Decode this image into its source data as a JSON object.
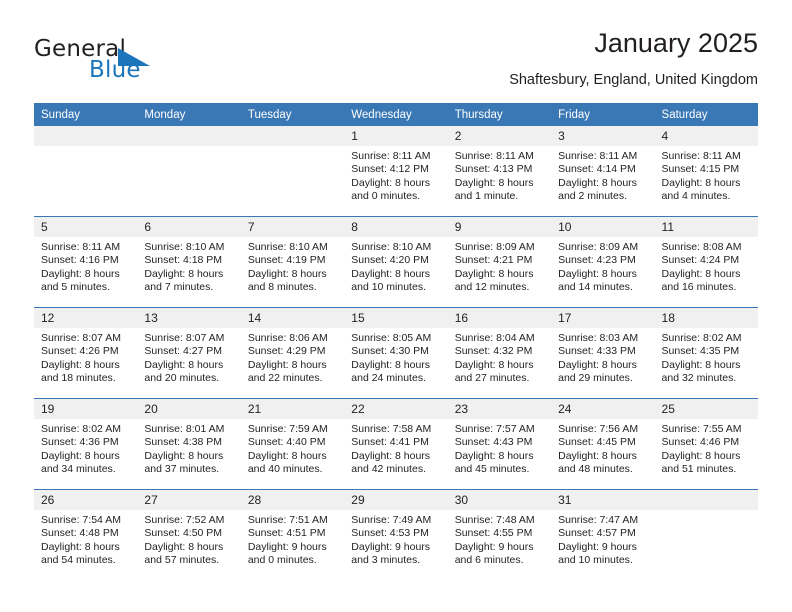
{
  "brand": {
    "word_one": "General",
    "word_two": "Blue",
    "triangle_icon": "triangle-icon",
    "colors": {
      "general": "#231f20",
      "blue": "#1b75bb"
    }
  },
  "header": {
    "title": "January 2025",
    "subtitle": "Shaftesbury, England, United Kingdom"
  },
  "theme": {
    "header_blue": "#3a78b5",
    "daynum_gray": "#f0f0f0",
    "text": "#231f20"
  },
  "calendar": {
    "weekday_headers": [
      "Sunday",
      "Monday",
      "Tuesday",
      "Wednesday",
      "Thursday",
      "Friday",
      "Saturday"
    ],
    "leading_blanks": 3,
    "weeks": [
      [
        {
          "blank": true
        },
        {
          "blank": true
        },
        {
          "blank": true
        },
        {
          "day": "1",
          "sunrise": "Sunrise: 8:11 AM",
          "sunset": "Sunset: 4:12 PM",
          "daylight_1": "Daylight: 8 hours",
          "daylight_2": "and 0 minutes."
        },
        {
          "day": "2",
          "sunrise": "Sunrise: 8:11 AM",
          "sunset": "Sunset: 4:13 PM",
          "daylight_1": "Daylight: 8 hours",
          "daylight_2": "and 1 minute."
        },
        {
          "day": "3",
          "sunrise": "Sunrise: 8:11 AM",
          "sunset": "Sunset: 4:14 PM",
          "daylight_1": "Daylight: 8 hours",
          "daylight_2": "and 2 minutes."
        },
        {
          "day": "4",
          "sunrise": "Sunrise: 8:11 AM",
          "sunset": "Sunset: 4:15 PM",
          "daylight_1": "Daylight: 8 hours",
          "daylight_2": "and 4 minutes."
        }
      ],
      [
        {
          "day": "5",
          "sunrise": "Sunrise: 8:11 AM",
          "sunset": "Sunset: 4:16 PM",
          "daylight_1": "Daylight: 8 hours",
          "daylight_2": "and 5 minutes."
        },
        {
          "day": "6",
          "sunrise": "Sunrise: 8:10 AM",
          "sunset": "Sunset: 4:18 PM",
          "daylight_1": "Daylight: 8 hours",
          "daylight_2": "and 7 minutes."
        },
        {
          "day": "7",
          "sunrise": "Sunrise: 8:10 AM",
          "sunset": "Sunset: 4:19 PM",
          "daylight_1": "Daylight: 8 hours",
          "daylight_2": "and 8 minutes."
        },
        {
          "day": "8",
          "sunrise": "Sunrise: 8:10 AM",
          "sunset": "Sunset: 4:20 PM",
          "daylight_1": "Daylight: 8 hours",
          "daylight_2": "and 10 minutes."
        },
        {
          "day": "9",
          "sunrise": "Sunrise: 8:09 AM",
          "sunset": "Sunset: 4:21 PM",
          "daylight_1": "Daylight: 8 hours",
          "daylight_2": "and 12 minutes."
        },
        {
          "day": "10",
          "sunrise": "Sunrise: 8:09 AM",
          "sunset": "Sunset: 4:23 PM",
          "daylight_1": "Daylight: 8 hours",
          "daylight_2": "and 14 minutes."
        },
        {
          "day": "11",
          "sunrise": "Sunrise: 8:08 AM",
          "sunset": "Sunset: 4:24 PM",
          "daylight_1": "Daylight: 8 hours",
          "daylight_2": "and 16 minutes."
        }
      ],
      [
        {
          "day": "12",
          "sunrise": "Sunrise: 8:07 AM",
          "sunset": "Sunset: 4:26 PM",
          "daylight_1": "Daylight: 8 hours",
          "daylight_2": "and 18 minutes."
        },
        {
          "day": "13",
          "sunrise": "Sunrise: 8:07 AM",
          "sunset": "Sunset: 4:27 PM",
          "daylight_1": "Daylight: 8 hours",
          "daylight_2": "and 20 minutes."
        },
        {
          "day": "14",
          "sunrise": "Sunrise: 8:06 AM",
          "sunset": "Sunset: 4:29 PM",
          "daylight_1": "Daylight: 8 hours",
          "daylight_2": "and 22 minutes."
        },
        {
          "day": "15",
          "sunrise": "Sunrise: 8:05 AM",
          "sunset": "Sunset: 4:30 PM",
          "daylight_1": "Daylight: 8 hours",
          "daylight_2": "and 24 minutes."
        },
        {
          "day": "16",
          "sunrise": "Sunrise: 8:04 AM",
          "sunset": "Sunset: 4:32 PM",
          "daylight_1": "Daylight: 8 hours",
          "daylight_2": "and 27 minutes."
        },
        {
          "day": "17",
          "sunrise": "Sunrise: 8:03 AM",
          "sunset": "Sunset: 4:33 PM",
          "daylight_1": "Daylight: 8 hours",
          "daylight_2": "and 29 minutes."
        },
        {
          "day": "18",
          "sunrise": "Sunrise: 8:02 AM",
          "sunset": "Sunset: 4:35 PM",
          "daylight_1": "Daylight: 8 hours",
          "daylight_2": "and 32 minutes."
        }
      ],
      [
        {
          "day": "19",
          "sunrise": "Sunrise: 8:02 AM",
          "sunset": "Sunset: 4:36 PM",
          "daylight_1": "Daylight: 8 hours",
          "daylight_2": "and 34 minutes."
        },
        {
          "day": "20",
          "sunrise": "Sunrise: 8:01 AM",
          "sunset": "Sunset: 4:38 PM",
          "daylight_1": "Daylight: 8 hours",
          "daylight_2": "and 37 minutes."
        },
        {
          "day": "21",
          "sunrise": "Sunrise: 7:59 AM",
          "sunset": "Sunset: 4:40 PM",
          "daylight_1": "Daylight: 8 hours",
          "daylight_2": "and 40 minutes."
        },
        {
          "day": "22",
          "sunrise": "Sunrise: 7:58 AM",
          "sunset": "Sunset: 4:41 PM",
          "daylight_1": "Daylight: 8 hours",
          "daylight_2": "and 42 minutes."
        },
        {
          "day": "23",
          "sunrise": "Sunrise: 7:57 AM",
          "sunset": "Sunset: 4:43 PM",
          "daylight_1": "Daylight: 8 hours",
          "daylight_2": "and 45 minutes."
        },
        {
          "day": "24",
          "sunrise": "Sunrise: 7:56 AM",
          "sunset": "Sunset: 4:45 PM",
          "daylight_1": "Daylight: 8 hours",
          "daylight_2": "and 48 minutes."
        },
        {
          "day": "25",
          "sunrise": "Sunrise: 7:55 AM",
          "sunset": "Sunset: 4:46 PM",
          "daylight_1": "Daylight: 8 hours",
          "daylight_2": "and 51 minutes."
        }
      ],
      [
        {
          "day": "26",
          "sunrise": "Sunrise: 7:54 AM",
          "sunset": "Sunset: 4:48 PM",
          "daylight_1": "Daylight: 8 hours",
          "daylight_2": "and 54 minutes."
        },
        {
          "day": "27",
          "sunrise": "Sunrise: 7:52 AM",
          "sunset": "Sunset: 4:50 PM",
          "daylight_1": "Daylight: 8 hours",
          "daylight_2": "and 57 minutes."
        },
        {
          "day": "28",
          "sunrise": "Sunrise: 7:51 AM",
          "sunset": "Sunset: 4:51 PM",
          "daylight_1": "Daylight: 9 hours",
          "daylight_2": "and 0 minutes."
        },
        {
          "day": "29",
          "sunrise": "Sunrise: 7:49 AM",
          "sunset": "Sunset: 4:53 PM",
          "daylight_1": "Daylight: 9 hours",
          "daylight_2": "and 3 minutes."
        },
        {
          "day": "30",
          "sunrise": "Sunrise: 7:48 AM",
          "sunset": "Sunset: 4:55 PM",
          "daylight_1": "Daylight: 9 hours",
          "daylight_2": "and 6 minutes."
        },
        {
          "day": "31",
          "sunrise": "Sunrise: 7:47 AM",
          "sunset": "Sunset: 4:57 PM",
          "daylight_1": "Daylight: 9 hours",
          "daylight_2": "and 10 minutes."
        },
        {
          "blank": true
        }
      ]
    ]
  }
}
